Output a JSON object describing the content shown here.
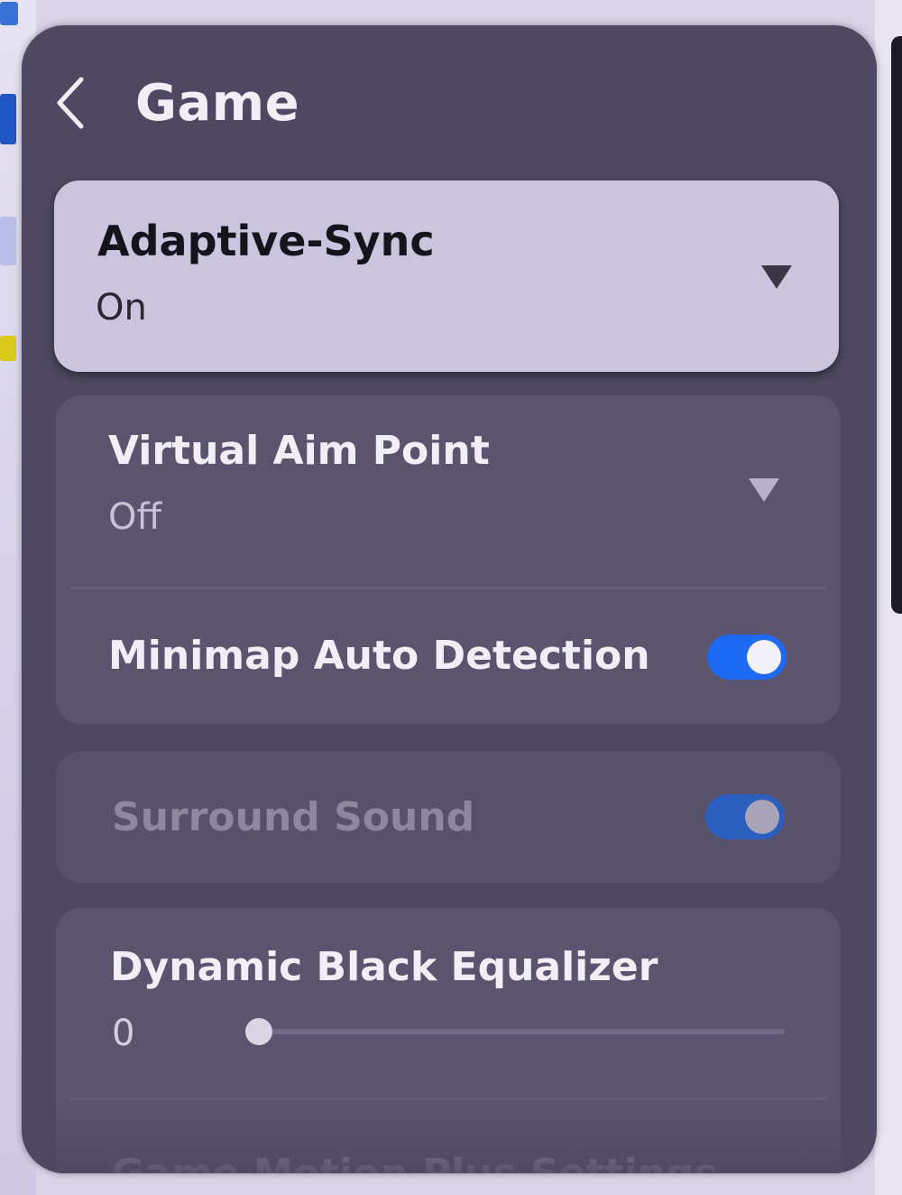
{
  "header": {
    "title": "Game"
  },
  "settings": {
    "adaptive_sync": {
      "label": "Adaptive-Sync",
      "value": "On"
    },
    "virtual_aim_point": {
      "label": "Virtual Aim Point",
      "value": "Off"
    },
    "minimap_auto_detection": {
      "label": "Minimap Auto Detection",
      "enabled": true
    },
    "surround_sound": {
      "label": "Surround Sound",
      "enabled": true,
      "disabled_state": true
    },
    "dynamic_black_equalizer": {
      "label": "Dynamic Black Equalizer",
      "value": "0",
      "slider_fraction": 0.0
    },
    "game_motion_plus": {
      "label": "Game Motion Plus Settings"
    }
  },
  "colors": {
    "panel_bg": "#4e4862",
    "card_bg": "#5a546e",
    "selected_card_bg": "#cbc4de",
    "toggle_on": "#1d6af5",
    "text_primary": "#f1eef8",
    "text_dark": "#15131c"
  }
}
